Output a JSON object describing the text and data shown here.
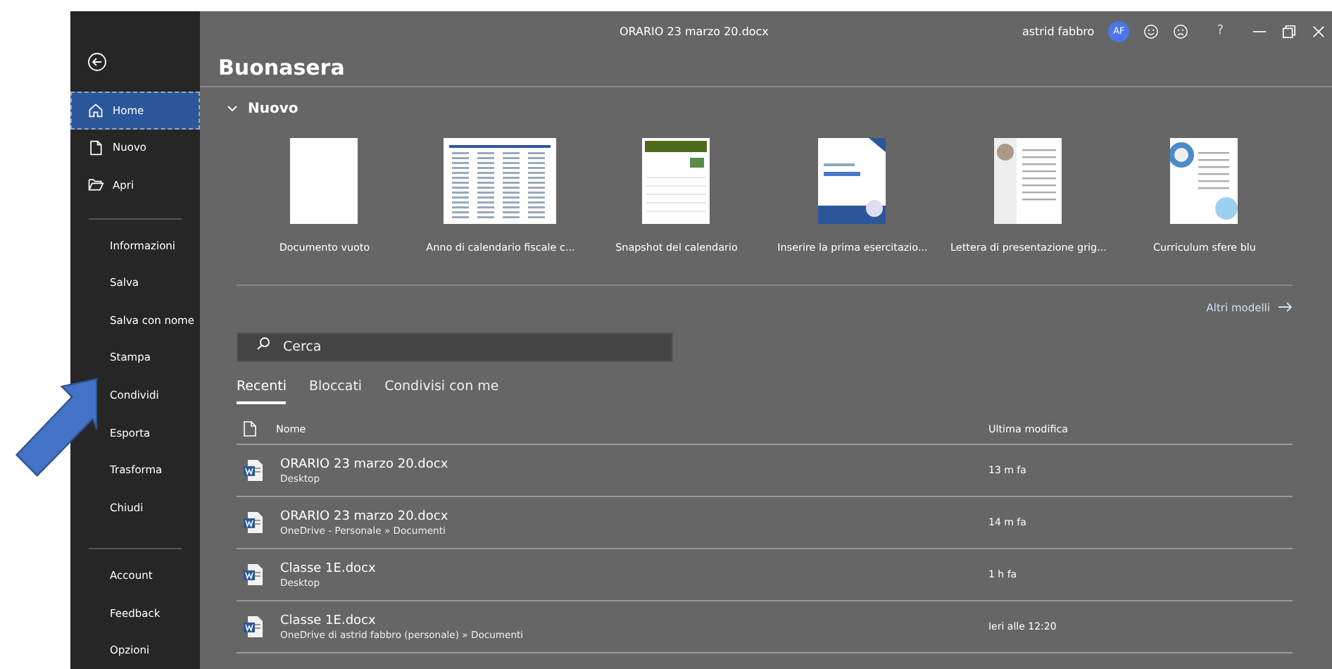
{
  "window": {
    "title": "ORARIO 23 marzo 20.docx",
    "user": "astrid fabbro",
    "avatar_initials": "AF",
    "help": "?"
  },
  "sidebar": {
    "top_items": [
      {
        "label": "Home",
        "selected": true
      },
      {
        "label": "Nuovo",
        "selected": false
      },
      {
        "label": "Apri",
        "selected": false
      }
    ],
    "items": [
      {
        "label": "Informazioni",
        "selected": false
      },
      {
        "label": "Salva",
        "selected": false
      },
      {
        "label": "Salva con nome",
        "selected": false
      },
      {
        "label": "Stampa",
        "selected": false
      },
      {
        "label": "Condividi",
        "selected": false
      },
      {
        "label": "Esporta",
        "selected": false
      },
      {
        "label": "Trasforma",
        "selected": false
      },
      {
        "label": "Chiudi",
        "selected": false
      }
    ],
    "bottom_items": [
      {
        "label": "Account",
        "selected": false
      },
      {
        "label": "Feedback",
        "selected": false
      },
      {
        "label": "Opzioni",
        "selected": false
      }
    ]
  },
  "greeting": "Buonasera",
  "new_section": {
    "title": "Nuovo",
    "expanded": true,
    "templates": [
      {
        "label": "Documento vuoto",
        "kind": "blank"
      },
      {
        "label": "Anno di calendario fiscale c...",
        "kind": "table"
      },
      {
        "label": "Snapshot del calendario",
        "kind": "calendar"
      },
      {
        "label": "Inserire la prima esercitazio...",
        "kind": "cover"
      },
      {
        "label": "Lettera di presentazione grig...",
        "kind": "letter"
      },
      {
        "label": "Curriculum sfere blu",
        "kind": "resume"
      }
    ],
    "more_link": "Altri modelli"
  },
  "search": {
    "placeholder": "Cerca"
  },
  "tabs": [
    {
      "label": "Recenti",
      "selected": true
    },
    {
      "label": "Bloccati",
      "selected": false
    },
    {
      "label": "Condivisi con me",
      "selected": false
    }
  ],
  "table": {
    "columns": [
      "Nome",
      "Ultima modifica"
    ],
    "rows": [
      {
        "name": "ORARIO 23 marzo 20.docx",
        "location": "Desktop",
        "modified": "13 m fa"
      },
      {
        "name": "ORARIO 23 marzo 20.docx",
        "location": "OneDrive - Personale » Documenti",
        "modified": "14 m fa"
      },
      {
        "name": "Classe 1E.docx",
        "location": "Desktop",
        "modified": "1 h fa"
      },
      {
        "name": "Classe 1E.docx",
        "location": "OneDrive di astrid fabbro (personale) » Documenti",
        "modified": "Ieri alle 12:20"
      }
    ]
  }
}
